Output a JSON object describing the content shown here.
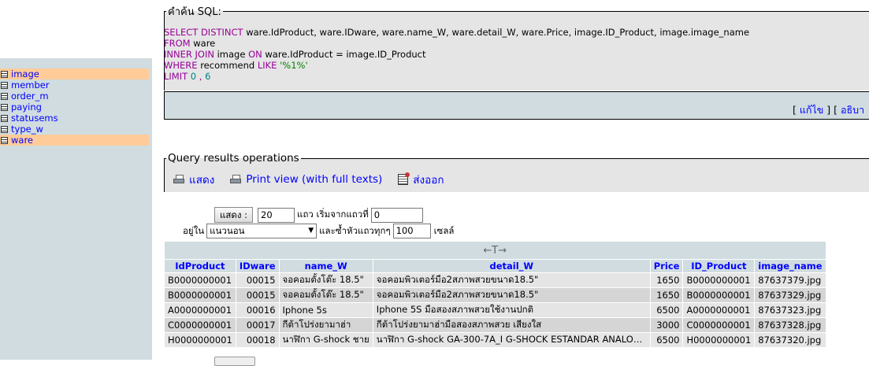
{
  "sidebar": {
    "tables": [
      {
        "name": "image",
        "highlighted": true
      },
      {
        "name": "member",
        "highlighted": false
      },
      {
        "name": "order_m",
        "highlighted": false
      },
      {
        "name": "paying",
        "highlighted": false
      },
      {
        "name": "statusems",
        "highlighted": false
      },
      {
        "name": "type_w",
        "highlighted": false
      },
      {
        "name": "ware",
        "highlighted": true
      }
    ]
  },
  "sql_box": {
    "legend": "คำค้น SQL:",
    "line1": {
      "kw": "SELECT DISTINCT",
      "rest": " ware.IdProduct, ware.IDware, ware.name_W, ware.detail_W, ware.Price, image.ID_Product, image.image_name"
    },
    "line2": {
      "kw": "FROM",
      "rest": " ware"
    },
    "line3": {
      "kw1": "INNER JOIN",
      "mid1": " image ",
      "kw2": "ON",
      "mid2": " ware.IdProduct = image.ID_Product"
    },
    "line4": {
      "kw1": "WHERE",
      "mid": " recommend ",
      "kw2": "LIKE",
      "str": " '%1%'"
    },
    "line5": {
      "kw": "LIMIT",
      "n1": " 0 ",
      "sep": ",",
      "n2": " 6"
    },
    "edit_link": "แก้ไข",
    "explain_link": "อธิบา",
    "bracket_open": "[ ",
    "bracket_mid": " ] [ "
  },
  "operations": {
    "legend": "Query results operations",
    "show_label": "แสดง",
    "print_view_label": "Print view (with full texts)",
    "export_label": "ส่งออก"
  },
  "navigation": {
    "show_button": "แสดง :",
    "rows_value": "20",
    "rows_label": "แถว เริ่มจากแถวที่",
    "start_value": "0",
    "mode_label": "อยู่ใน",
    "mode_value": "แนวนอน",
    "repeat_label": "และซ้ำหัวแถวทุกๆ",
    "repeat_value": "100",
    "cells_label": "เซลล์"
  },
  "results": {
    "sort_arrows": "←T→",
    "columns": [
      "IdProduct",
      "IDware",
      "name_W",
      "detail_W",
      "Price",
      "ID_Product",
      "image_name"
    ],
    "rows": [
      [
        "B0000000001",
        "00015",
        "จอคอมตั้งโต๊ะ 18.5\"",
        "จอคอมพิวเตอร์มือ2สภาพสวยขนาด18.5\"",
        "1650",
        "B0000000001",
        "87637379.jpg"
      ],
      [
        "B0000000001",
        "00015",
        "จอคอมตั้งโต๊ะ 18.5\"",
        "จอคอมพิวเตอร์มือ2สภาพสวยขนาด18.5\"",
        "1650",
        "B0000000001",
        "87637329.jpg"
      ],
      [
        "A0000000001",
        "00016",
        "Iphone 5s",
        "Iphone 5S มือสองสภาพสวยใช้งานปกติ",
        "6500",
        "A0000000001",
        "87637323.jpg"
      ],
      [
        "C0000000001",
        "00017",
        "กีต้าโปร่งยามาฮ่า",
        "กีต้าโปร่งยามาฮ่ามือสองสภาพสวย เสียงใส",
        "3000",
        "C0000000001",
        "87637328.jpg"
      ],
      [
        "H0000000001",
        "00018",
        "นาฬิกา G-shock ชาย",
        "นาฬิกา G-shock GA-300-7A_I G-SHOCK ESTANDAR ANALOG...",
        "6500",
        "H0000000001",
        "87637320.jpg"
      ]
    ]
  }
}
